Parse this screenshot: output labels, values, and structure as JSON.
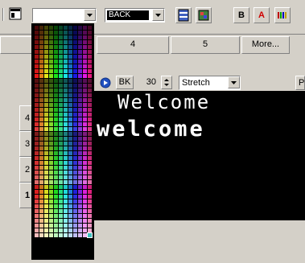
{
  "toolbar": {
    "color_value": "",
    "background_select": "BACK",
    "bold_label": "B",
    "font_color_label": "A"
  },
  "tabs": [
    "4",
    "5",
    "More..."
  ],
  "left_tabs": [
    "4",
    "3",
    "2",
    "1"
  ],
  "controls": {
    "bk_label": "BK",
    "size_value": "30",
    "mode_select": "Stretch",
    "right_button": "P"
  },
  "display": {
    "line1": "Welcome",
    "line2": "welcome",
    "background": "#000000",
    "text_color": "#ffffff"
  },
  "palette": {
    "rows": 44,
    "cols": 12,
    "selected": "#40c0c0"
  },
  "icons": [
    "panel-icon",
    "dropdown-arrow-icon",
    "layout-icon",
    "image-icon",
    "color-bars-icon",
    "play-icon"
  ]
}
